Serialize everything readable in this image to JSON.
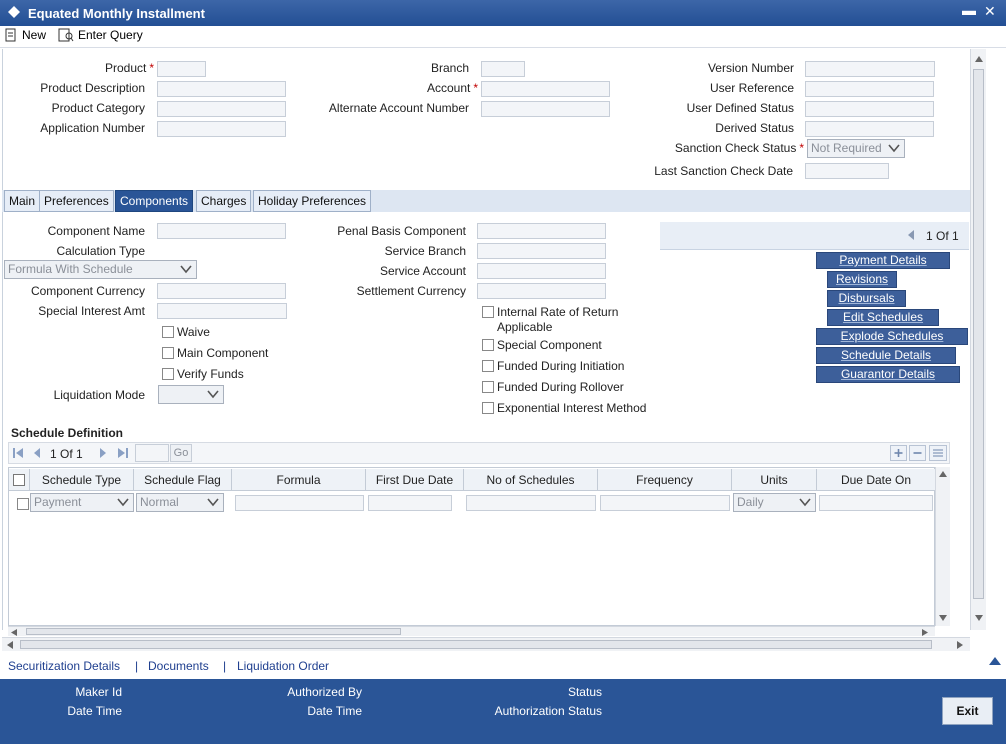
{
  "window": {
    "title": "Equated Monthly Installment",
    "minimize": "▬",
    "close": "✕"
  },
  "toolbar": {
    "new_label": "New",
    "enter_query_label": "Enter Query"
  },
  "header_fields": {
    "product": "Product",
    "product_description": "Product Description",
    "product_category": "Product Category",
    "application_number": "Application Number",
    "branch": "Branch",
    "account": "Account",
    "alternate_account_number": "Alternate Account Number",
    "version_number": "Version Number",
    "user_reference": "User Reference",
    "user_defined_status": "User Defined Status",
    "derived_status": "Derived Status",
    "sanction_check_status": "Sanction Check Status",
    "sanction_check_status_value": "Not Required",
    "last_sanction_check_date": "Last Sanction Check Date"
  },
  "tabs": [
    {
      "label": "Main"
    },
    {
      "label": "Preferences"
    },
    {
      "label": "Components"
    },
    {
      "label": "Charges"
    },
    {
      "label": "Holiday Preferences"
    }
  ],
  "components": {
    "component_name": "Component Name",
    "calculation_type": "Calculation Type",
    "calculation_type_value": "Formula With Schedule",
    "component_currency": "Component Currency",
    "special_interest_amt": "Special Interest Amt",
    "waive": "Waive",
    "main_component": "Main Component",
    "verify_funds": "Verify Funds",
    "liquidation_mode": "Liquidation Mode",
    "penal_basis_component": "Penal Basis Component",
    "service_branch": "Service Branch",
    "service_account": "Service Account",
    "settlement_currency": "Settlement Currency",
    "irr_applicable_line1": "Internal Rate of Return",
    "irr_applicable_line2": "Applicable",
    "special_component": "Special Component",
    "funded_during_initiation": "Funded During Initiation",
    "funded_during_rollover": "Funded During Rollover",
    "exponential_interest_method": "Exponential Interest Method",
    "pager": "1 Of 1"
  },
  "action_buttons": [
    {
      "label": "Payment Details"
    },
    {
      "label": "Revisions"
    },
    {
      "label": "Disbursals"
    },
    {
      "label": "Edit Schedules"
    },
    {
      "label": "Explode Schedules"
    },
    {
      "label": "Schedule Details"
    },
    {
      "label": "Guarantor Details"
    }
  ],
  "schedule": {
    "title": "Schedule Definition",
    "pager": "1 Of 1",
    "go_label": "Go",
    "columns": [
      "Schedule Type",
      "Schedule Flag",
      "Formula",
      "First Due Date",
      "No of Schedules",
      "Frequency",
      "Units",
      "Due Date On"
    ],
    "row": {
      "schedule_type": "Payment",
      "schedule_flag": "Normal",
      "units": "Daily"
    }
  },
  "footer_links": [
    "Securitization Details",
    "Documents",
    "Liquidation Order"
  ],
  "footer": {
    "maker_id": "Maker Id",
    "date_time_1": "Date Time",
    "authorized_by": "Authorized By",
    "date_time_2": "Date Time",
    "status": "Status",
    "authorization_status": "Authorization Status",
    "exit_label": "Exit"
  },
  "colors": {
    "title_bar": "#234f94",
    "active_tab": "#2a5597",
    "action_button": "#3d5f9a",
    "footer": "#2a5597",
    "required": "#c00000"
  }
}
